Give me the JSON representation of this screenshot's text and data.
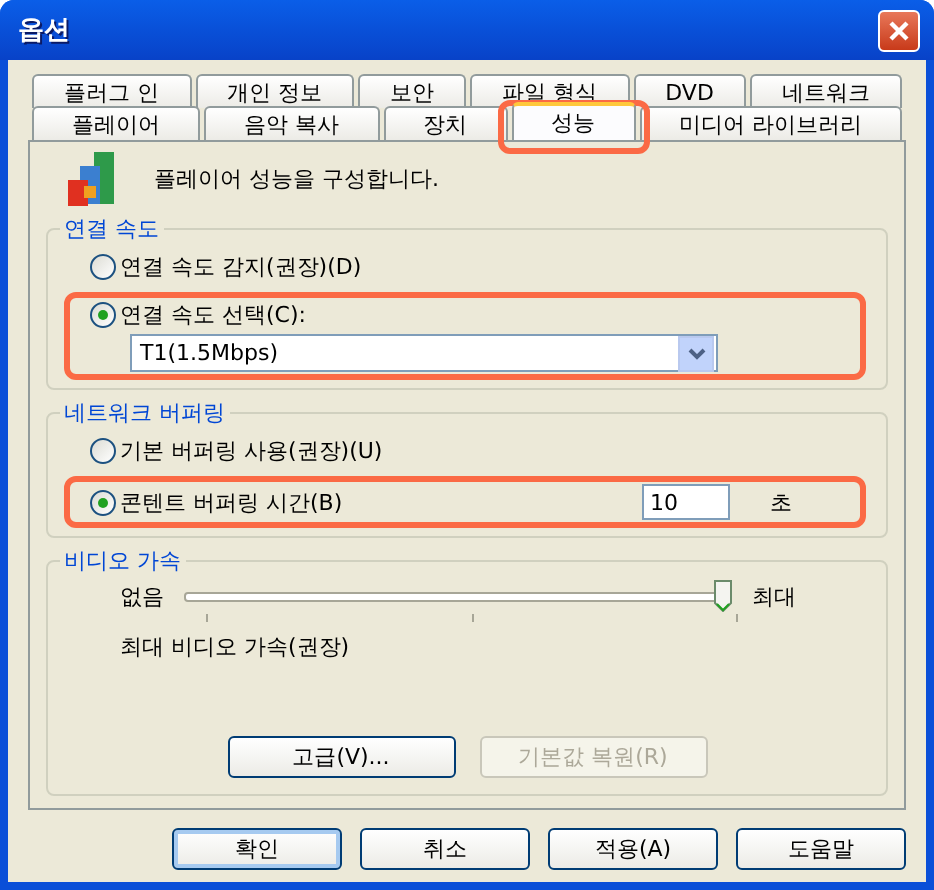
{
  "window": {
    "title": "옵션"
  },
  "tab_rows": [
    {
      "tabs": [
        {
          "label": "플러그 인",
          "selected": false,
          "highlighted": false
        },
        {
          "label": "개인 정보",
          "selected": false,
          "highlighted": false
        },
        {
          "label": "보안",
          "selected": false,
          "highlighted": false
        },
        {
          "label": "파일 형식",
          "selected": false,
          "highlighted": false
        },
        {
          "label": "DVD",
          "selected": false,
          "highlighted": false
        },
        {
          "label": "네트워크",
          "selected": false,
          "highlighted": false
        }
      ]
    },
    {
      "tabs": [
        {
          "label": "플레이어",
          "selected": false,
          "highlighted": false
        },
        {
          "label": "음악 복사",
          "selected": false,
          "highlighted": false
        },
        {
          "label": "장치",
          "selected": false,
          "highlighted": false
        },
        {
          "label": "성능",
          "selected": true,
          "highlighted": true
        },
        {
          "label": "미디어 라이브러리",
          "selected": false,
          "highlighted": false
        }
      ]
    }
  ],
  "description": "플레이어 성능을 구성합니다.",
  "groups": [
    {
      "title": "연결 속도",
      "options": [
        {
          "kind": "plain",
          "label": "연결 속도 감지(권장)(D)",
          "selected": false,
          "highlighted": false
        },
        {
          "kind": "dropdown",
          "label": "연결 속도 선택(C):",
          "selected": true,
          "highlighted": true,
          "value": "T1(1.5Mbps)"
        }
      ]
    },
    {
      "title": "네트워크 버퍼링",
      "options": [
        {
          "kind": "plain",
          "label": "기본 버퍼링 사용(권장)(U)",
          "selected": false,
          "highlighted": false
        },
        {
          "kind": "field",
          "label": "콘텐트 버퍼링 시간(B)",
          "selected": true,
          "highlighted": true,
          "value": "10",
          "unit": "초"
        }
      ]
    }
  ],
  "video": {
    "title": "비디오 가속",
    "min_label": "없음",
    "max_label": "최대",
    "level": 1.0,
    "caption": "최대 비디오 가속(권장)",
    "buttons": [
      {
        "label": "고급(V)...",
        "disabled": false
      },
      {
        "label": "기본값 복원(R)",
        "disabled": true
      }
    ]
  },
  "footer_buttons": [
    {
      "label": "확인",
      "default": true
    },
    {
      "label": "취소",
      "default": false
    },
    {
      "label": "적용(A)",
      "default": false
    },
    {
      "label": "도움말",
      "default": false
    }
  ]
}
